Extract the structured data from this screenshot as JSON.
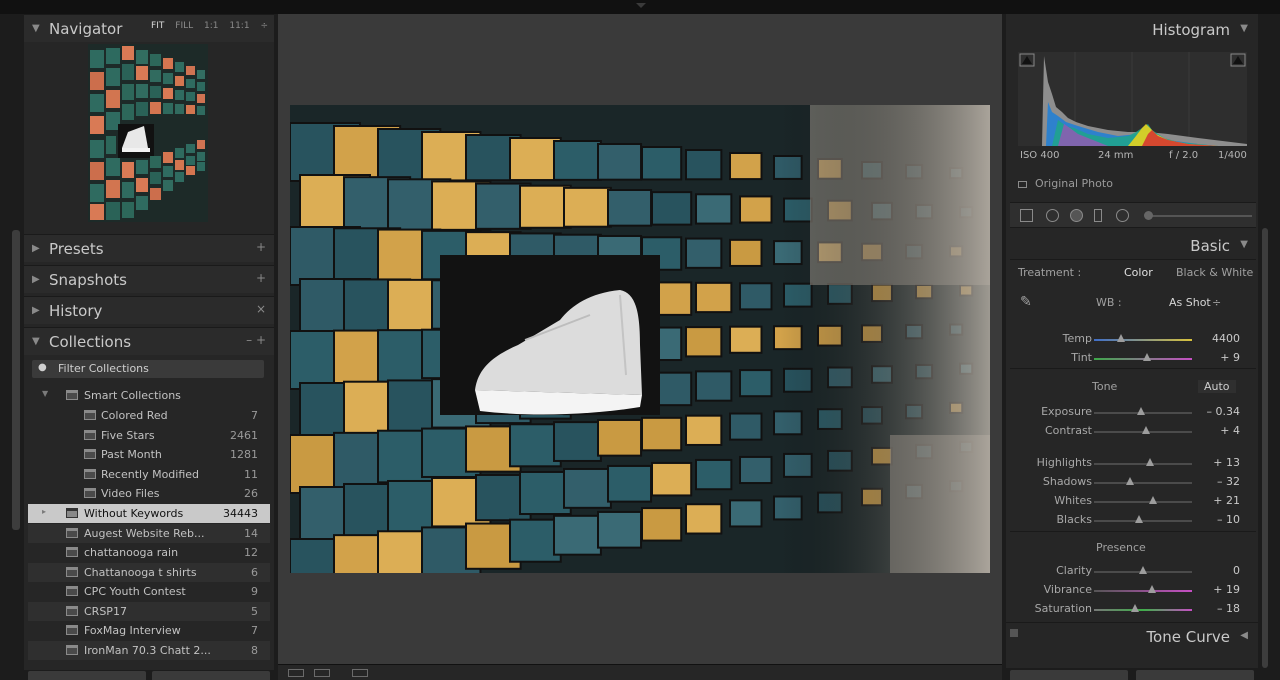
{
  "navigator": {
    "title": "Navigator",
    "zoom_options": [
      "FIT",
      "FILL",
      "1:1",
      "11:1"
    ]
  },
  "panels": {
    "presets": "Presets",
    "snapshots": "Snapshots",
    "history": "History",
    "history_action": "×",
    "collections": "Collections",
    "collections_actions": "– +",
    "add": "+"
  },
  "collections": {
    "filter_label": "Filter Collections",
    "smart_collections_label": "Smart Collections",
    "smart_items": [
      {
        "label": "Colored Red",
        "count": "7"
      },
      {
        "label": "Five Stars",
        "count": "2461"
      },
      {
        "label": "Past Month",
        "count": "1281"
      },
      {
        "label": "Recently Modified",
        "count": "11"
      },
      {
        "label": "Video Files",
        "count": "26"
      }
    ],
    "items": [
      {
        "label": "Without Keywords",
        "count": "34443",
        "selected": true
      },
      {
        "label": "Augest Website Reb...",
        "count": "14"
      },
      {
        "label": "chattanooga rain",
        "count": "12"
      },
      {
        "label": "Chattanooga t shirts",
        "count": "6"
      },
      {
        "label": "CPC Youth Contest",
        "count": "9"
      },
      {
        "label": "CRSP17",
        "count": "5"
      },
      {
        "label": "FoxMag Interview",
        "count": "7"
      },
      {
        "label": "IronMan 70.3 Chatt 2...",
        "count": "8"
      }
    ]
  },
  "histogram": {
    "title": "Histogram",
    "iso": "ISO 400",
    "focal": "24 mm",
    "aperture": "f / 2.0",
    "shutter": "1/400",
    "original_photo": "Original Photo"
  },
  "basic": {
    "title": "Basic",
    "treatment_label": "Treatment :",
    "treatment_color": "Color",
    "treatment_bw": "Black & White",
    "wb_label": "WB :",
    "wb_value": "As Shot",
    "wb_arrows": "÷",
    "temp": {
      "label": "Temp",
      "value": "4400",
      "pos": 0.28
    },
    "tint": {
      "label": "Tint",
      "value": "+ 9",
      "pos": 0.54
    },
    "tone_label": "Tone",
    "auto_label": "Auto",
    "exposure": {
      "label": "Exposure",
      "value": "– 0.34",
      "pos": 0.48
    },
    "contrast": {
      "label": "Contrast",
      "value": "+ 4",
      "pos": 0.53
    },
    "highlights": {
      "label": "Highlights",
      "value": "+ 13",
      "pos": 0.57
    },
    "shadows": {
      "label": "Shadows",
      "value": "– 32",
      "pos": 0.37
    },
    "whites": {
      "label": "Whites",
      "value": "+ 21",
      "pos": 0.6
    },
    "blacks": {
      "label": "Blacks",
      "value": "– 10",
      "pos": 0.46
    },
    "presence_label": "Presence",
    "clarity": {
      "label": "Clarity",
      "value": "0",
      "pos": 0.5
    },
    "vibrance": {
      "label": "Vibrance",
      "value": "+ 19",
      "pos": 0.59
    },
    "saturation": {
      "label": "Saturation",
      "value": "– 18",
      "pos": 0.42
    }
  },
  "tone_curve": {
    "title": "Tone Curve"
  },
  "colors": {
    "panel_bg": "#262626",
    "center_bg": "#3a3a3a",
    "selected_row": "#c9c9c9"
  }
}
